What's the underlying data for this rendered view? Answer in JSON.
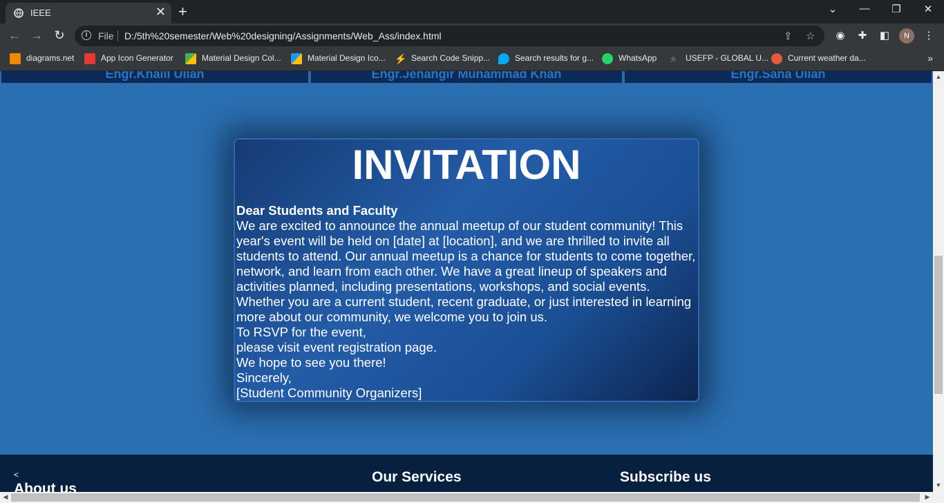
{
  "browser": {
    "tab_title": "IEEE",
    "new_tab_label": "+",
    "tab_close": "✕",
    "address": {
      "scheme_label": "File",
      "url": "D:/5th%20semester/Web%20designing/Assignments/Web_Ass/index.html"
    },
    "profile_initial": "N",
    "window_controls": {
      "dropdown": "⌄",
      "minimize": "—",
      "restore": "❐",
      "close": "✕"
    },
    "bookmarks": [
      {
        "label": "diagrams.net",
        "icon": "diagrams-icon",
        "color": "#f08705"
      },
      {
        "label": "App Icon Generator",
        "icon": "app-icon-generator-icon",
        "color": "#e53935"
      },
      {
        "label": "Material Design Col...",
        "icon": "material-colors-icon",
        "color": "#4caf50"
      },
      {
        "label": "Material Design Ico...",
        "icon": "material-icons-icon",
        "color": "#2196f3"
      },
      {
        "label": "Search Code Snipp...",
        "icon": "code-snippet-icon",
        "color": "#8bc34a"
      },
      {
        "label": "Search results for g...",
        "icon": "search-results-icon",
        "color": "#03a9f4"
      },
      {
        "label": "WhatsApp",
        "icon": "whatsapp-icon",
        "color": "#25d366"
      },
      {
        "label": "USEFP - GLOBAL U...",
        "icon": "usefp-icon",
        "color": "#4a6f4a"
      },
      {
        "label": "Current weather da...",
        "icon": "weather-icon",
        "color": "#e65a3c"
      }
    ],
    "more_bookmarks": "»"
  },
  "team": {
    "members": [
      "Engr.Khalil Ullah",
      "Engr.Jehangir Muhammad Khan",
      "Engr.Sana Ullah"
    ]
  },
  "invitation": {
    "title": "INVITATION",
    "greeting": "Dear Students and Faculty",
    "lines": [
      "We are excited to announce the annual meetup of our student community! This year's event will be held on [date] at [location], and we are thrilled to invite all students to attend. Our annual meetup is a chance for students to come together, network, and learn from each other. We have a great lineup of speakers and activities planned, including presentations, workshops, and social events. Whether you are a current student, recent graduate, or just interested in learning more about our community, we welcome you to join us.",
      "To RSVP for the event,",
      "please visit event registration page.",
      "We hope to see you there!",
      "Sincerely,",
      "[Student Community Organizers]"
    ]
  },
  "footer": {
    "arrow": "<",
    "about": "About us",
    "services": "Our Services",
    "subscribe": "Subscribe us"
  },
  "colors": {
    "page_bg": "#2a6fb0",
    "card_bg": "#245ca7",
    "footer_bg": "#07203f",
    "team_text": "#2f73c0"
  }
}
